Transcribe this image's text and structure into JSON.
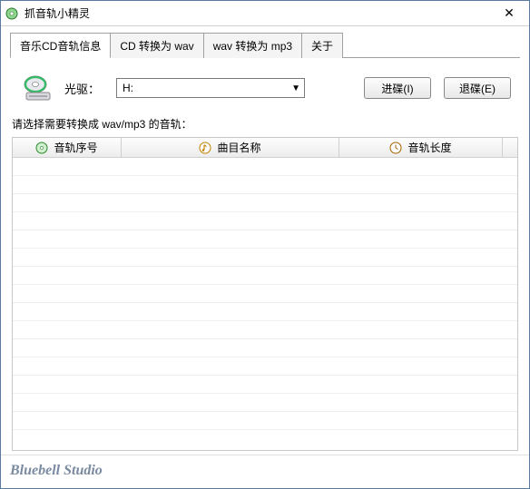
{
  "window": {
    "title": "抓音轨小精灵"
  },
  "tabs": [
    {
      "label": "音乐CD音轨信息",
      "active": true
    },
    {
      "label": "CD 转换为 wav"
    },
    {
      "label": "wav 转换为 mp3"
    },
    {
      "label": "关于"
    }
  ],
  "drive": {
    "label": "光驱：",
    "selected": "H:",
    "insert_button": "进碟(I)",
    "eject_button": "退碟(E)"
  },
  "instruction": "请选择需要转换成 wav/mp3 的音轨：",
  "columns": {
    "track_no": "音轨序号",
    "track_name": "曲目名称",
    "track_length": "音轨长度"
  },
  "footer": "Bluebell Studio"
}
